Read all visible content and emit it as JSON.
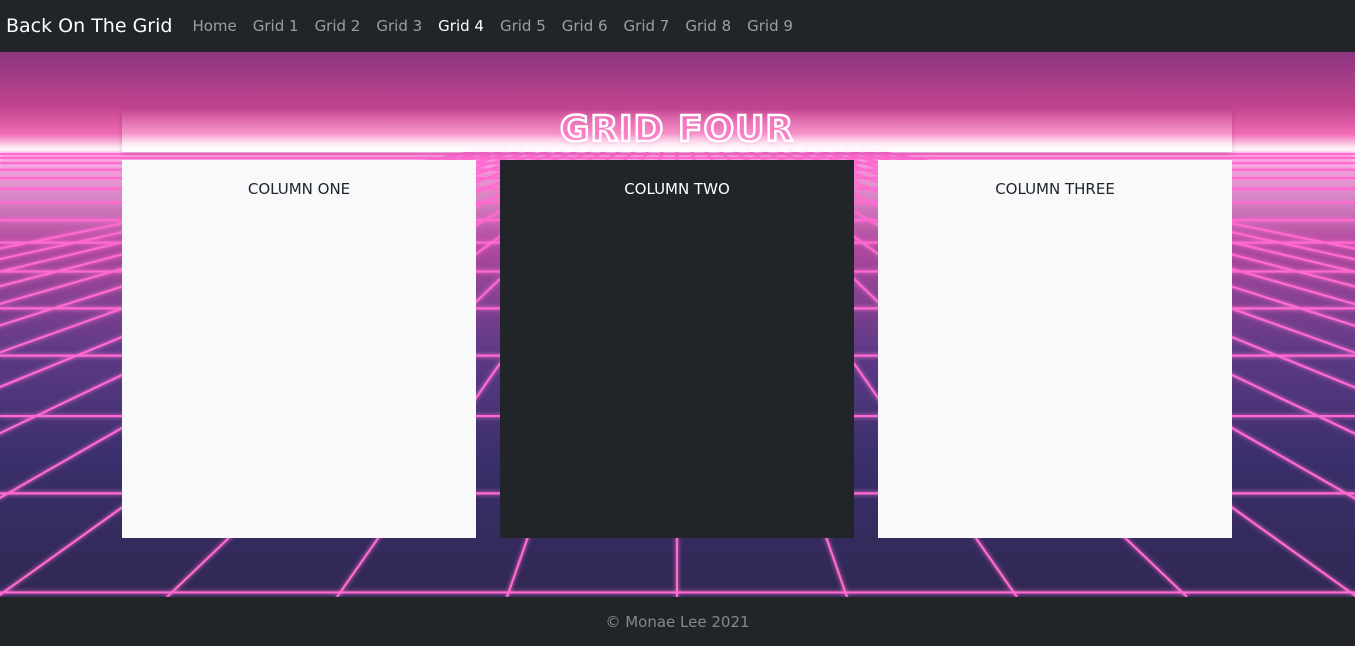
{
  "navbar": {
    "brand": "Back On The Grid",
    "links": [
      "Home",
      "Grid 1",
      "Grid 2",
      "Grid 3",
      "Grid 4",
      "Grid 5",
      "Grid 6",
      "Grid 7",
      "Grid 8",
      "Grid 9"
    ],
    "active_link": "Grid 4"
  },
  "hero": {
    "title": "GRID FOUR",
    "background": "retro-neon-grid",
    "accent_color": "#ff4fbf"
  },
  "columns": [
    {
      "label": "COLUMN ONE",
      "theme": "light"
    },
    {
      "label": "COLUMN TWO",
      "theme": "dark"
    },
    {
      "label": "COLUMN THREE",
      "theme": "light"
    }
  ],
  "footer": {
    "text": "© Monae Lee 2021"
  }
}
